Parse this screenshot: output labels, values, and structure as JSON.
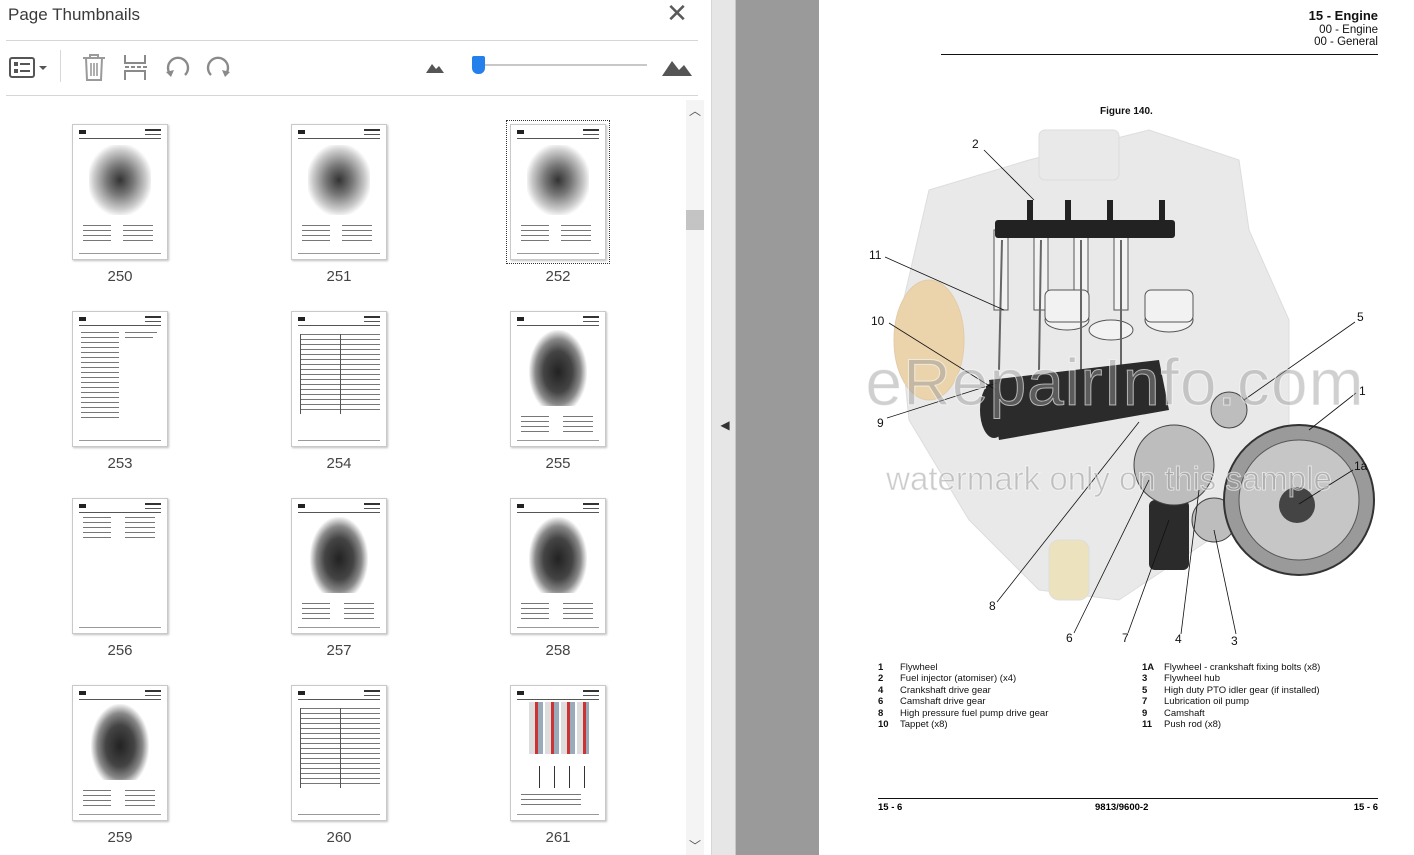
{
  "panel": {
    "title": "Page Thumbnails",
    "close_glyph": "✕",
    "toolbar": {
      "options_icon": "thumbnail-options-icon",
      "delete_icon": "trash-icon",
      "extract_icon": "extract-pages-icon",
      "rotate_left_icon": "rotate-left-icon",
      "rotate_right_icon": "rotate-right-icon",
      "zoom_out_icon": "small-mountain-icon",
      "zoom_in_icon": "large-mountain-icon",
      "thumbnail_size_level": 0.02
    },
    "selected_page": "252",
    "thumbnails": [
      {
        "page": "250",
        "kind": "engine-diagram"
      },
      {
        "page": "251",
        "kind": "engine-diagram"
      },
      {
        "page": "252",
        "kind": "engine-diagram"
      },
      {
        "page": "253",
        "kind": "text"
      },
      {
        "page": "254",
        "kind": "table"
      },
      {
        "page": "255",
        "kind": "engine-photo"
      },
      {
        "page": "256",
        "kind": "list"
      },
      {
        "page": "257",
        "kind": "engine-photo"
      },
      {
        "page": "258",
        "kind": "engine-photo"
      },
      {
        "page": "259",
        "kind": "engine-photo"
      },
      {
        "page": "260",
        "kind": "table"
      },
      {
        "page": "261",
        "kind": "injector-diagram"
      }
    ]
  },
  "document": {
    "chapter": "15 - Engine",
    "section1": "00 - Engine",
    "section2": "00 - General",
    "figure_title": "Figure 140.",
    "callouts": [
      "2",
      "11",
      "10",
      "9",
      "5",
      "1",
      "1a",
      "8",
      "6",
      "7",
      "4",
      "3"
    ],
    "watermark_line1": "eRepairInfo.com",
    "watermark_line2": "watermark only on this sample",
    "legend_left": [
      {
        "num": "1",
        "text": "Flywheel"
      },
      {
        "num": "2",
        "text": "Fuel injector (atomiser) (x4)"
      },
      {
        "num": "4",
        "text": "Crankshaft drive gear"
      },
      {
        "num": "6",
        "text": "Camshaft drive gear"
      },
      {
        "num": "8",
        "text": "High pressure fuel pump drive gear"
      },
      {
        "num": "10",
        "text": "Tappet (x8)"
      }
    ],
    "legend_right": [
      {
        "num": "1A",
        "text": "Flywheel - crankshaft fixing bolts (x8)"
      },
      {
        "num": "3",
        "text": "Flywheel hub"
      },
      {
        "num": "5",
        "text": "High duty PTO idler gear (if installed)"
      },
      {
        "num": "7",
        "text": "Lubrication oil pump"
      },
      {
        "num": "9",
        "text": "Camshaft"
      },
      {
        "num": "11",
        "text": "Push rod (x8)"
      }
    ],
    "footer_left": "15 - 6",
    "footer_mid": "9813/9600-2",
    "footer_right": "15 - 6"
  }
}
